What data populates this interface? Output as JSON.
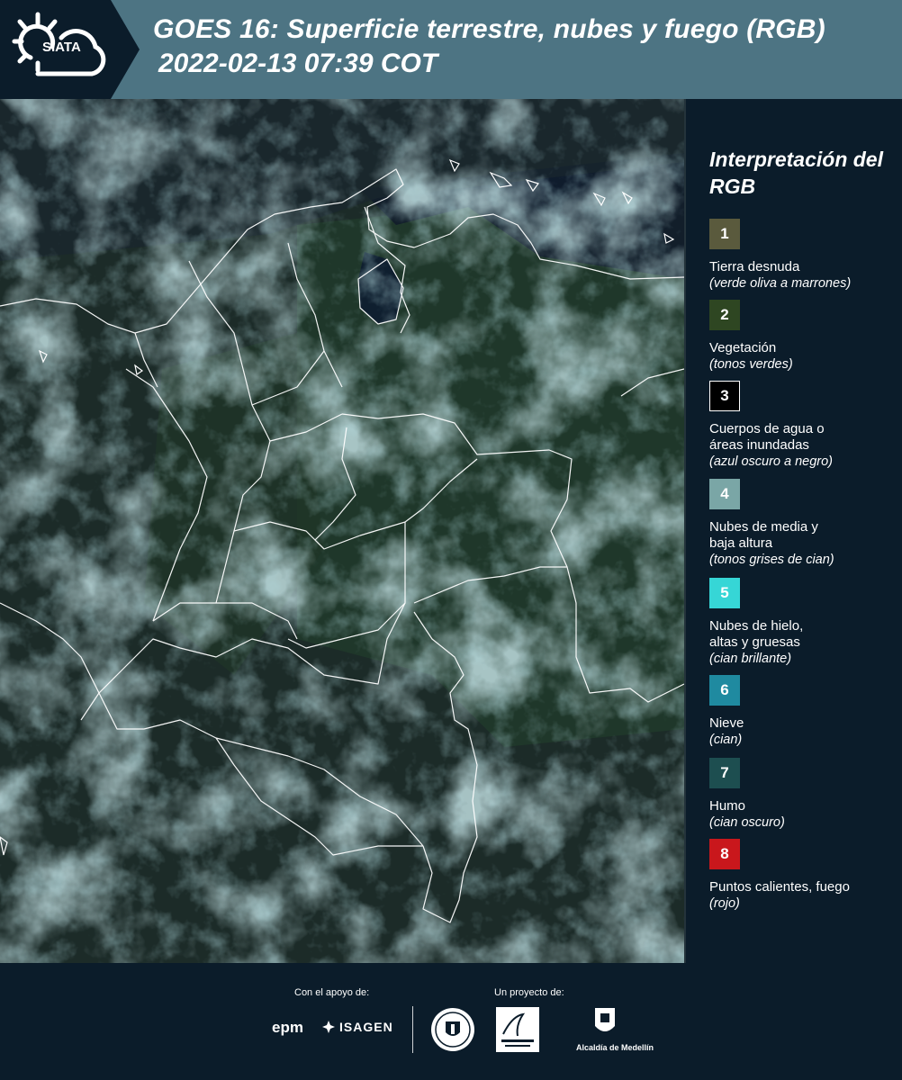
{
  "header": {
    "logo_text": "SIATA",
    "title": "GOES 16: Superficie terrestre, nubes y fuego (RGB)",
    "timestamp": "2022-02-13 07:39 COT"
  },
  "legend": {
    "title": "Interpretación del RGB",
    "items": [
      {
        "number": "1",
        "color": "#5a5a3d",
        "label": "Tierra desnuda",
        "note": "(verde oliva a marrones)"
      },
      {
        "number": "2",
        "color": "#2e4622",
        "label": "Vegetación",
        "note": "(tonos verdes)"
      },
      {
        "number": "3",
        "color": "#000000",
        "label": "Cuerpos de agua o\náreas inundadas",
        "note": "(azul oscuro a negro)"
      },
      {
        "number": "4",
        "color": "#7aa6a6",
        "label": "Nubes de media y\nbaja altura",
        "note": "(tonos grises de cian)"
      },
      {
        "number": "5",
        "color": "#36d6d6",
        "label": "Nubes de hielo,\naltas y gruesas",
        "note": "(cian brillante)"
      },
      {
        "number": "6",
        "color": "#1f8aa0",
        "label": "Nieve",
        "note": "(cian)"
      },
      {
        "number": "7",
        "color": "#1d4e50",
        "label": "Humo",
        "note": "(cian oscuro)"
      },
      {
        "number": "8",
        "color": "#c9171c",
        "label": "Puntos calientes, fuego",
        "note": "(rojo)"
      }
    ]
  },
  "footer": {
    "support_label": "Con el apoyo de:",
    "project_label": "Un proyecto de:",
    "sponsors": [
      "epm",
      "ISAGEN"
    ],
    "partners": [
      "Alcaldía de Medellín"
    ]
  },
  "colors": {
    "background": "#0b1c2a",
    "header_band": "#4d7483",
    "boundary_lines": "#ffffff"
  }
}
